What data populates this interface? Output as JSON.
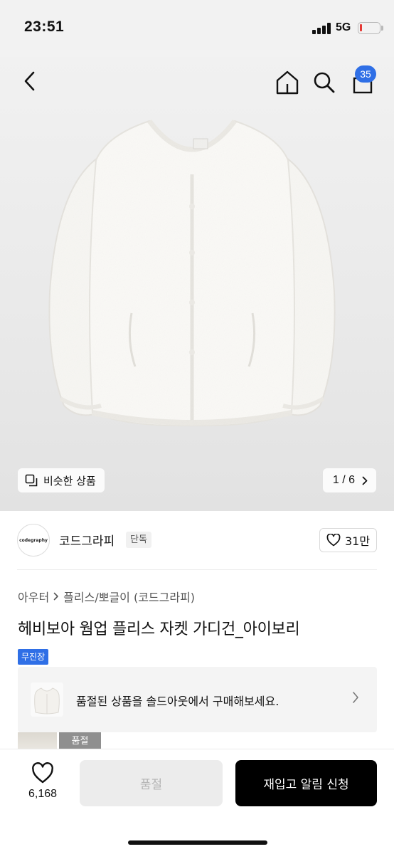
{
  "status_bar": {
    "time": "23:51",
    "network": "5G",
    "battery_level": 0.12,
    "battery_color": "#e53935"
  },
  "nav": {
    "back_icon": "chevron-left-icon",
    "home_icon": "home-icon",
    "search_icon": "search-icon",
    "cart_icon": "cart-icon",
    "cart_count": "35",
    "badge_color": "#2f6fe6"
  },
  "gallery": {
    "similar_label": "비슷한 상품",
    "page_indicator": "1 / 6"
  },
  "brand": {
    "logo_text": "codegraphy",
    "name": "코드그라피",
    "tag": "단독",
    "like_count": "31만"
  },
  "product": {
    "breadcrumb": [
      "아우터",
      "플리스/뽀글이 (코드그라피)"
    ],
    "title": "헤비보아 웜업 플리스 자켓 가디건_아이보리",
    "badge": "무진장"
  },
  "soldout_card": {
    "text": "품절된 상품을 솔드아웃에서 구매해보세요."
  },
  "thumbnails": {
    "soldout_label": "품절"
  },
  "bottom_bar": {
    "favorites": "6,168",
    "soldout_button": "품절",
    "restock_button": "재입고 알림 신청"
  }
}
